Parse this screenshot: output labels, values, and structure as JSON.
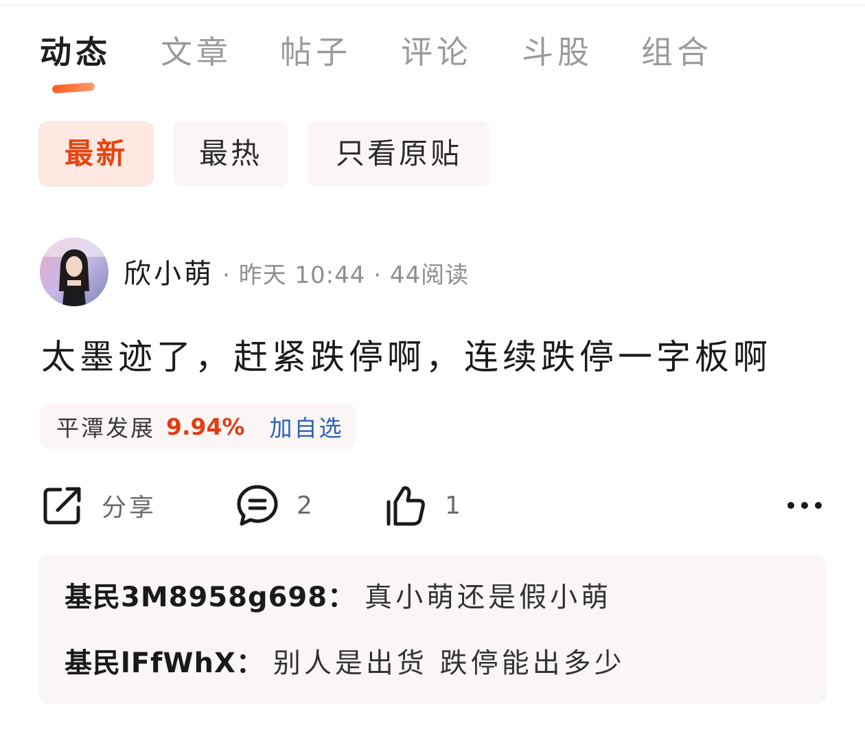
{
  "tabs": [
    {
      "label": "动态",
      "active": true
    },
    {
      "label": "文章",
      "active": false
    },
    {
      "label": "帖子",
      "active": false
    },
    {
      "label": "评论",
      "active": false
    },
    {
      "label": "斗股",
      "active": false
    },
    {
      "label": "组合",
      "active": false
    }
  ],
  "filters": [
    {
      "label": "最新",
      "active": true
    },
    {
      "label": "最热",
      "active": false
    },
    {
      "label": "只看原贴",
      "active": false
    }
  ],
  "post": {
    "author": "欣小萌",
    "meta": "· 昨天 10:44 · 44阅读",
    "body": "太墨迹了，赶紧跌停啊，连续跌停一字板啊",
    "stock": {
      "name": "平潭发展",
      "change": "9.94%",
      "add_label": "加自选"
    },
    "actions": {
      "share_label": "分享",
      "comment_count": "2",
      "like_count": "1"
    },
    "comments": [
      {
        "user": "基民3M8958g698",
        "colon": "：",
        "text": "真小萌还是假小萌"
      },
      {
        "user": "基民lFfWhX",
        "colon": "：",
        "text": "别人是出货 跌停能出多少"
      }
    ]
  },
  "colors": {
    "accent": "#e8440f",
    "price_up": "#e23c12",
    "link": "#2b62b8"
  },
  "icons": [
    "share-icon",
    "comment-icon",
    "like-icon",
    "more-icon"
  ]
}
